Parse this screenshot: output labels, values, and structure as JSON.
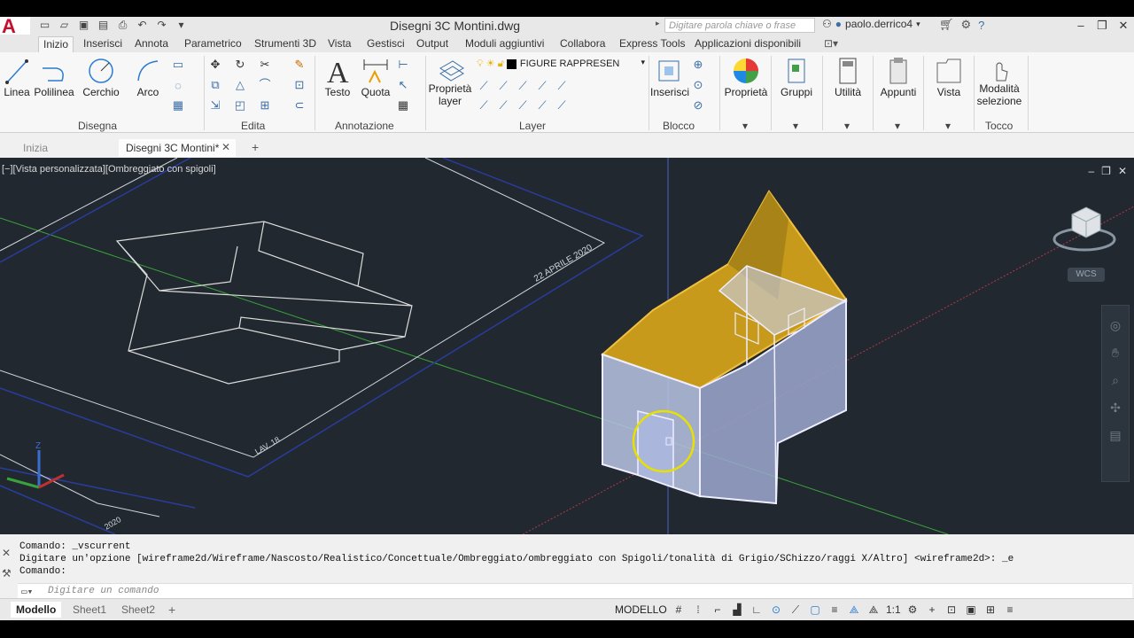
{
  "app": {
    "logo": "A",
    "title": "Disegni 3C Montini.dwg"
  },
  "search": {
    "placeholder": "Digitare parola chiave o frase"
  },
  "user": {
    "name": "paolo.derrico4"
  },
  "ribbon_tabs": [
    "Inizio",
    "Inserisci",
    "Annota",
    "Parametrico",
    "Strumenti 3D",
    "Vista",
    "Gestisci",
    "Output",
    "Moduli aggiuntivi",
    "Collabora",
    "Express Tools",
    "Applicazioni disponibili"
  ],
  "draw_panel": {
    "title": "Disegna",
    "linea": "Linea",
    "polilinea": "Polilinea",
    "cerchio": "Cerchio",
    "arco": "Arco"
  },
  "edit_panel": {
    "title": "Edita"
  },
  "annot_panel": {
    "title": "Annotazione",
    "testo": "Testo",
    "quota": "Quota"
  },
  "layer_panel": {
    "title": "Layer",
    "props": "Proprietà layer",
    "current_layer": "FIGURE RAPPRESEN"
  },
  "block_panel": {
    "title": "Blocco",
    "insert": "Inserisci"
  },
  "big_buttons": {
    "proprieta": "Proprietà",
    "gruppi": "Gruppi",
    "utilita": "Utilità",
    "appunti": "Appunti",
    "vista": "Vista",
    "modalita": "Modalità selezione",
    "tocco": "Tocco"
  },
  "file_tabs": {
    "start": "Inizia",
    "doc": "Disegni 3C Montini*"
  },
  "viewport": {
    "label": "[−][Vista personalizzata][Ombreggiato con spigoli]",
    "wcs": "WCS",
    "stamp1": "22 APRILE 2020",
    "stamp2": "LAV. 18",
    "stamp3": "2020"
  },
  "command": {
    "line1": "Comando: _vscurrent",
    "line2": "Digitare un'opzione [wireframe2d/Wireframe/Nascosto/Realistico/Concettuale/Ombreggiato/ombreggiato con Spigoli/tonalità di Grigio/SChizzo/raggi X/Altro] <wireframe2d>: _e",
    "line3": "Comando:",
    "placeholder": "Digitare un comando"
  },
  "status": {
    "tab_model": "Modello",
    "tab_sheet1": "Sheet1",
    "tab_sheet2": "Sheet2",
    "mode": "MODELLO",
    "scale": "1:1"
  },
  "colors": {
    "roof": "#e8b020",
    "wall": "#b8c4e4",
    "viewport_bg": "#212830",
    "highlight": "#e8e000"
  }
}
